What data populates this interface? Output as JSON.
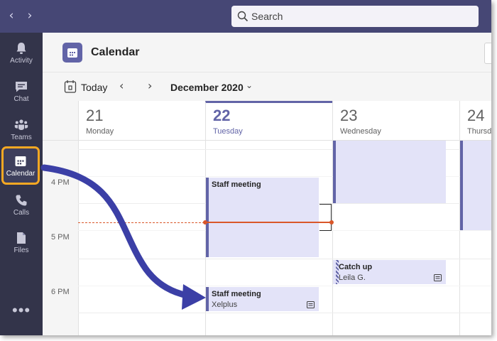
{
  "topbar": {
    "search_placeholder": "Search",
    "back_icon": "chevron-left-icon",
    "forward_icon": "chevron-right-icon"
  },
  "rail": {
    "items": [
      {
        "label": "Activity",
        "icon": "bell-icon"
      },
      {
        "label": "Chat",
        "icon": "chat-icon"
      },
      {
        "label": "Teams",
        "icon": "teams-icon"
      },
      {
        "label": "Calendar",
        "icon": "calendar-icon",
        "active": true
      },
      {
        "label": "Calls",
        "icon": "phone-icon"
      },
      {
        "label": "Files",
        "icon": "file-icon"
      }
    ],
    "more": "•••"
  },
  "header": {
    "title": "Calendar"
  },
  "toolbar": {
    "today_label": "Today",
    "month_label": "December 2020"
  },
  "days": [
    {
      "num": "21",
      "name": "Monday"
    },
    {
      "num": "22",
      "name": "Tuesday",
      "today": true
    },
    {
      "num": "23",
      "name": "Wednesday"
    },
    {
      "num": "24",
      "name": "Thursday"
    }
  ],
  "times": [
    "4 PM",
    "5 PM",
    "6 PM"
  ],
  "events": [
    {
      "title": "Staff meeting",
      "sub": "",
      "day": "Tuesday",
      "time": "4 PM"
    },
    {
      "title": "Staff meeting",
      "sub": "Xelplus",
      "day": "Tuesday",
      "time": "6 PM"
    },
    {
      "title": "Catch up",
      "sub": "Leila G.",
      "day": "Wednesday",
      "time": "5:30 PM"
    },
    {
      "title": "",
      "sub": "",
      "day": "Wednesday",
      "time": "3 PM"
    },
    {
      "title": "",
      "sub": "",
      "day": "Thursday",
      "time": "3 PM"
    }
  ],
  "colors": {
    "brand": "#6264a7",
    "topbar": "#464775",
    "rail": "#33344a",
    "highlight": "#f7a823",
    "now_line": "#d9572a",
    "annotation_arrow": "#3b3fa6"
  }
}
